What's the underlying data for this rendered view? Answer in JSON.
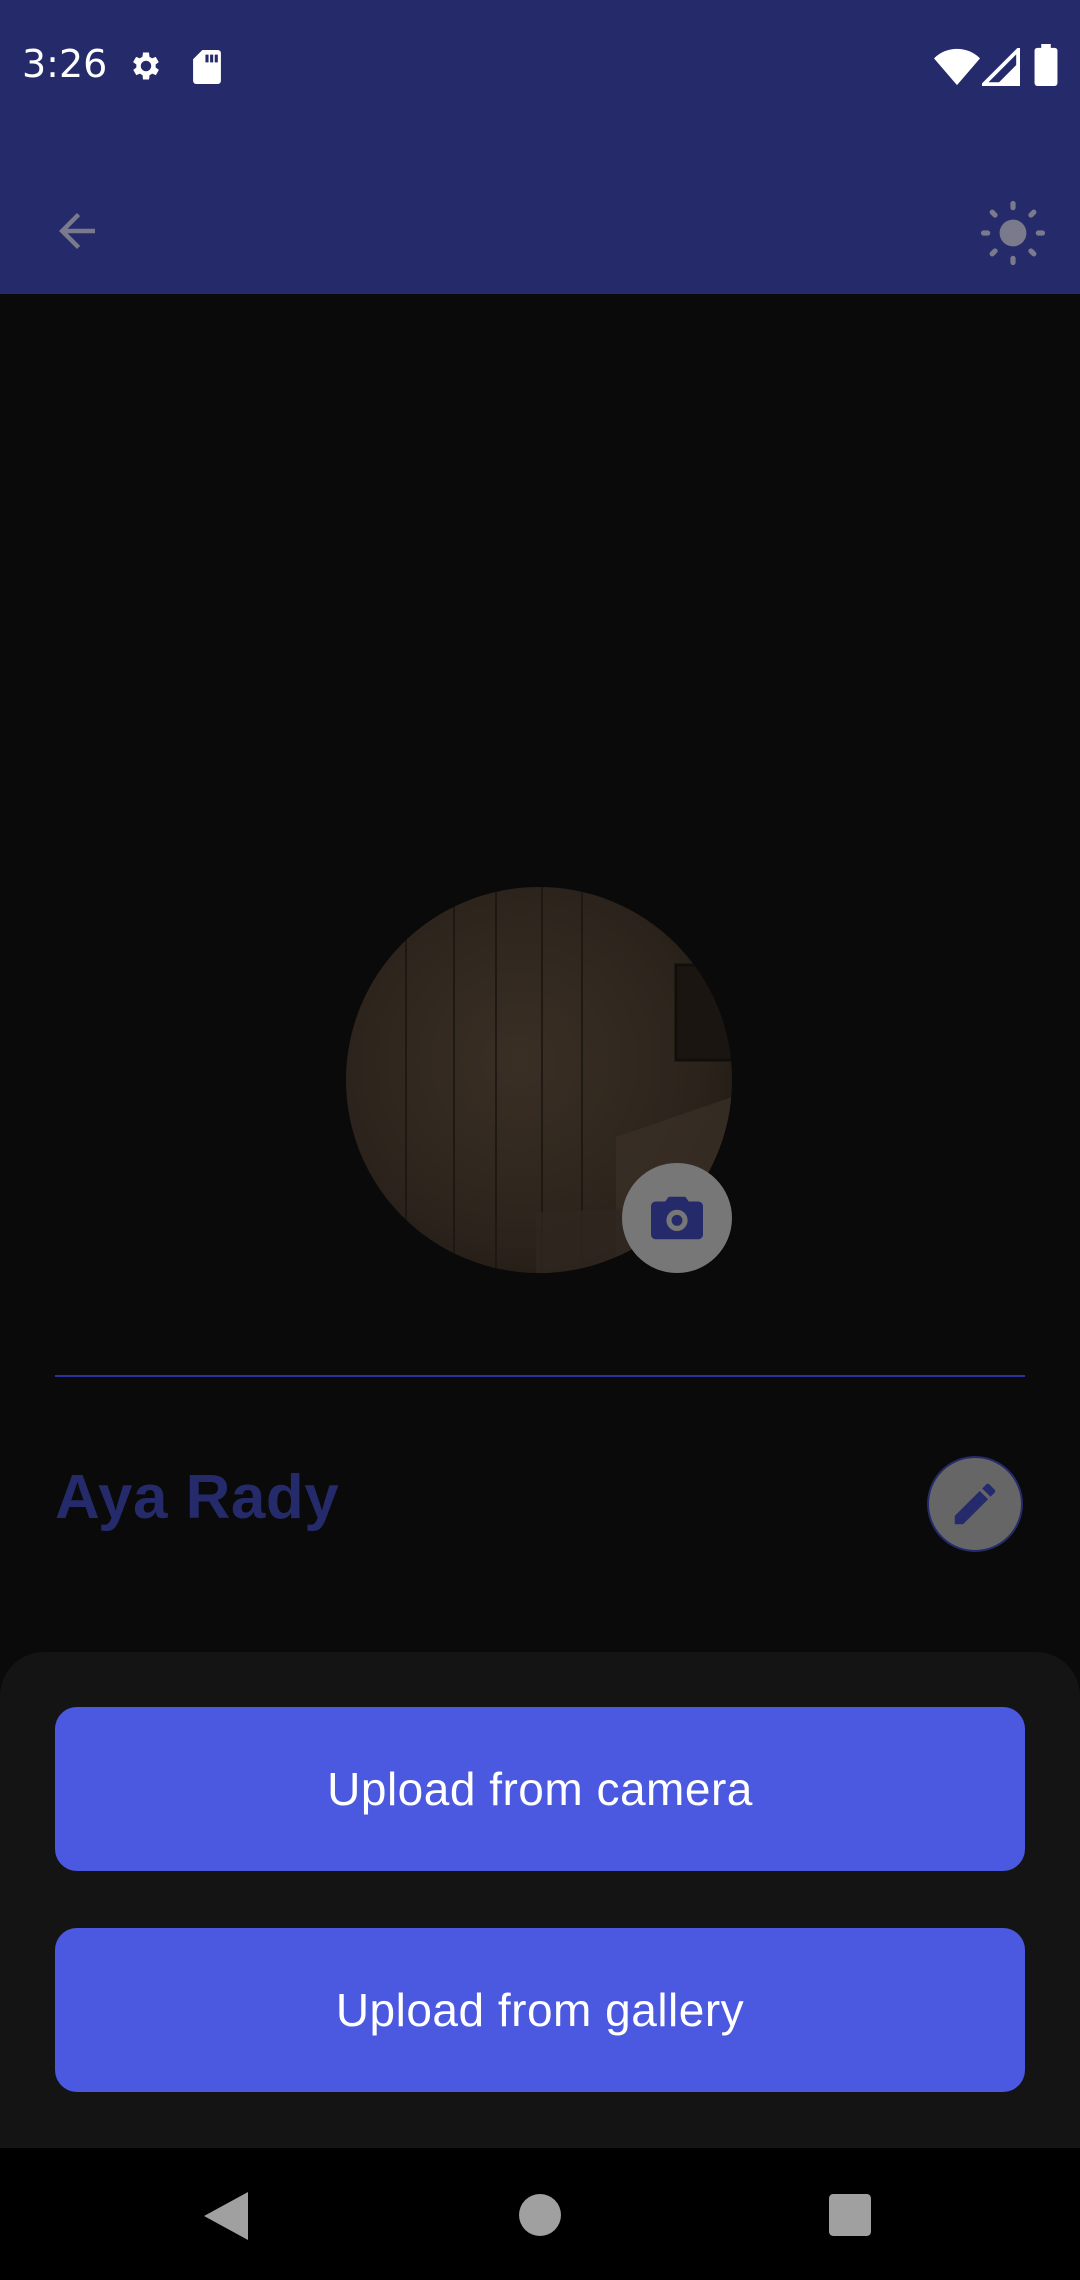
{
  "status_bar": {
    "time": "3:26",
    "left_icons": [
      "settings-gear-icon",
      "sd-card-icon"
    ],
    "right_icons": [
      "wifi-icon",
      "cell-signal-icon",
      "battery-icon"
    ]
  },
  "app_bar": {
    "back_icon": "arrow-back-icon",
    "theme_icon": "sun-brightness-icon"
  },
  "profile": {
    "name": "Aya Rady",
    "camera_icon": "camera-icon",
    "edit_icon": "pencil-icon"
  },
  "bottom_sheet": {
    "camera_button_label": "Upload from camera",
    "gallery_button_label": "Upload from gallery"
  },
  "nav_bar": {
    "back": "nav-back-icon",
    "home": "nav-home-icon",
    "recents": "nav-recents-icon"
  },
  "colors": {
    "header": "#252a6a",
    "accent": "#4b58e0",
    "background": "#0a0a0a",
    "sheet": "#141414"
  }
}
